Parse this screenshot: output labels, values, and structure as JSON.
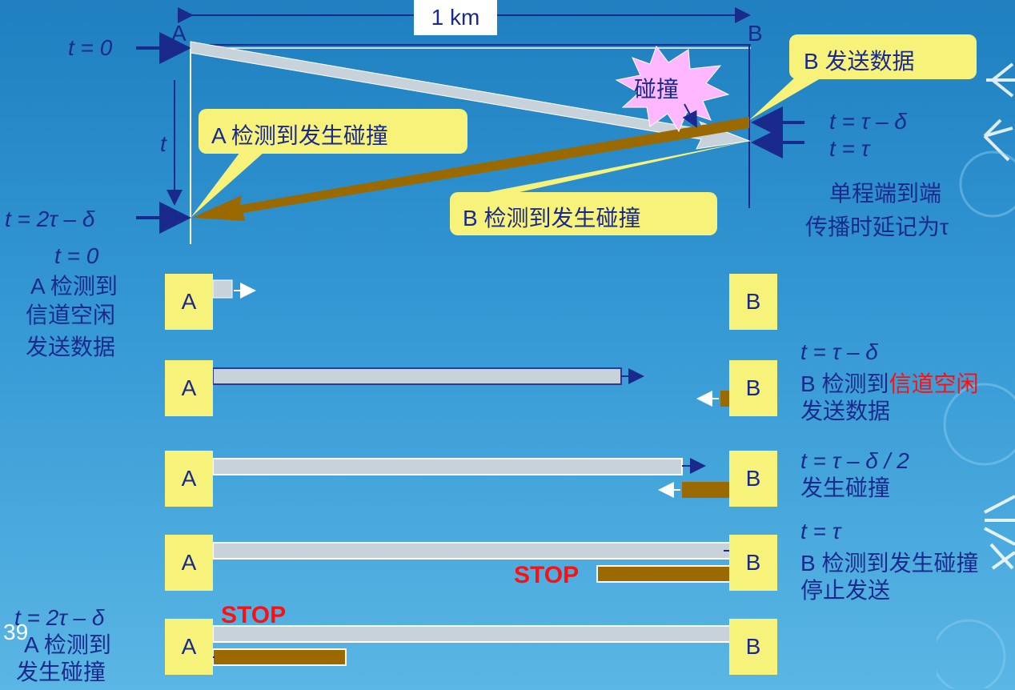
{
  "distance_label": "1 km",
  "node_a_top": "A",
  "node_b_top": "B",
  "time_labels": {
    "t0": "t = 0",
    "t_axis": "t",
    "t2tau": "t = 2τ – δ",
    "t_tau_minus_delta": "t = τ – δ",
    "t_tau": "t = τ"
  },
  "callouts": {
    "b_sends": "B 发送数据",
    "collision": "碰撞",
    "a_detects": "A 检测到发生碰撞",
    "b_detects": "B 检测到发生碰撞"
  },
  "note": [
    "单程端到端",
    "传播时延记为τ"
  ],
  "steps": [
    {
      "node_a": "A",
      "node_b": "B",
      "left": [
        "t = 0",
        "A 检测到",
        "信道空闲",
        "发送数据"
      ],
      "right": []
    },
    {
      "node_a": "A",
      "node_b": "B",
      "left": [],
      "right_time": "t = τ – δ",
      "right_l1a": "B 检测到",
      "right_l1b": "信道空闲",
      "right_l2": "发送数据"
    },
    {
      "node_a": "A",
      "node_b": "B",
      "left": [],
      "right_time": "t = τ – δ / 2",
      "right_l1": "发生碰撞"
    },
    {
      "node_a": "A",
      "node_b": "B",
      "left": [],
      "right_time": "t = τ",
      "right_l1": "B 检测到发生碰撞",
      "right_l2": "停止发送",
      "stop": "STOP"
    },
    {
      "node_a": "A",
      "node_b": "B",
      "left_time": "t = 2τ – δ",
      "left_l1": "A 检测到",
      "left_l2": "发生碰撞",
      "stop": "STOP"
    }
  ],
  "page_number": "39",
  "colors": {
    "frame_a": "#c8d2da",
    "frame_b": "#9a6a00",
    "highlight": "#ff1010",
    "callout": "#f7f27a"
  }
}
